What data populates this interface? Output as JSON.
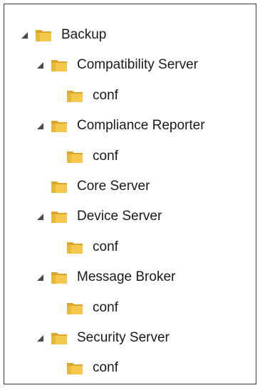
{
  "tree": {
    "root": {
      "label": "Backup",
      "expanded": true,
      "icon": "folder-icon"
    },
    "items": [
      {
        "label": "Compatibility Server",
        "expanded": true,
        "icon": "folder-icon",
        "children": [
          {
            "label": "conf",
            "icon": "folder-icon"
          }
        ]
      },
      {
        "label": "Compliance Reporter",
        "expanded": true,
        "icon": "folder-icon",
        "children": [
          {
            "label": "conf",
            "icon": "folder-icon"
          }
        ]
      },
      {
        "label": "Core Server",
        "expanded": false,
        "icon": "folder-icon",
        "children": []
      },
      {
        "label": "Device Server",
        "expanded": true,
        "icon": "folder-icon",
        "children": [
          {
            "label": "conf",
            "icon": "folder-icon"
          }
        ]
      },
      {
        "label": "Message Broker",
        "expanded": true,
        "icon": "folder-icon",
        "children": [
          {
            "label": "conf",
            "icon": "folder-icon"
          }
        ]
      },
      {
        "label": "Security Server",
        "expanded": true,
        "icon": "folder-icon",
        "children": [
          {
            "label": "conf",
            "icon": "folder-icon"
          }
        ]
      }
    ]
  },
  "colors": {
    "folder_front": "#f2c94c",
    "folder_back": "#d9a52a",
    "arrow": "#4a4a4a",
    "border": "#3a3a3a",
    "text": "#1a1a1a"
  }
}
